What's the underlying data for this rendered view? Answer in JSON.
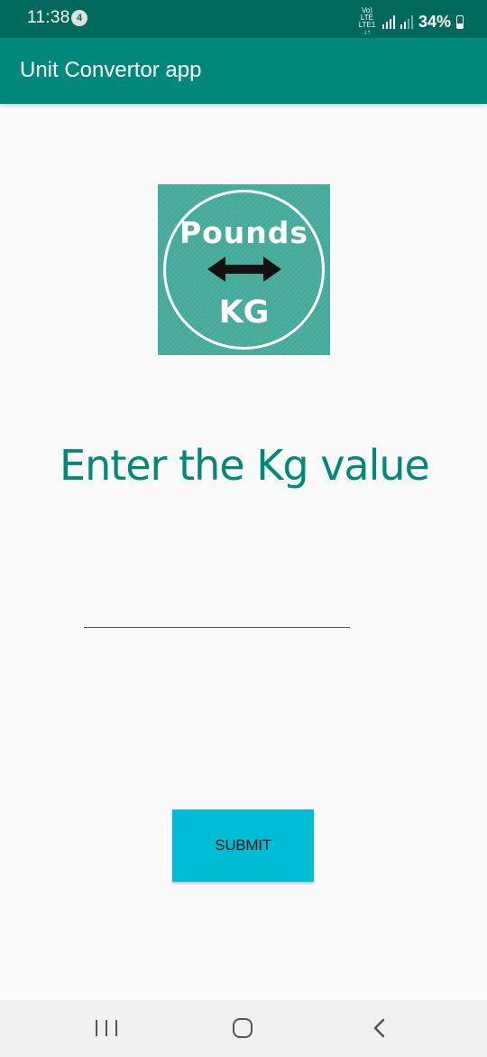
{
  "status_bar": {
    "time": "11:38",
    "notification_count": "4",
    "network_label_top": "Vo) LTE",
    "network_label_bottom": "LTE1 ↓↑",
    "battery": "34%"
  },
  "app_bar": {
    "title": "Unit Convertor app"
  },
  "logo": {
    "top_text": "Pounds",
    "bottom_text": "KG",
    "bg_color": "#4caf9f"
  },
  "main": {
    "heading": "Enter the Kg value",
    "input_value": "",
    "input_placeholder": "",
    "submit_label": "SUBMIT"
  },
  "nav_bar": {
    "recents_icon": "recents-icon",
    "home_icon": "home-icon",
    "back_icon": "back-icon"
  },
  "colors": {
    "status_bar": "#00695c",
    "app_bar": "#00897b",
    "heading": "#00897b",
    "button": "#00bcd4"
  }
}
